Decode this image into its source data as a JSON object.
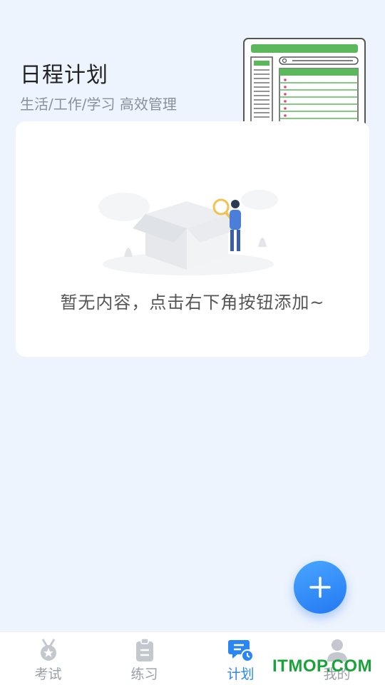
{
  "header": {
    "title": "日程计划",
    "subtitle": "生活/工作/学习 高效管理"
  },
  "empty_state": {
    "message": "暂无内容，点击右下角按钮添加~"
  },
  "fab": {
    "icon": "plus-icon"
  },
  "tabbar": {
    "tabs": [
      {
        "label": "考试",
        "icon": "medal-icon",
        "active": false
      },
      {
        "label": "练习",
        "icon": "clipboard-icon",
        "active": false
      },
      {
        "label": "计划",
        "icon": "plan-clock-icon",
        "active": true
      },
      {
        "label": "我的",
        "icon": "person-icon",
        "active": false
      }
    ]
  },
  "watermark": {
    "text": "ITMOP.COM"
  },
  "colors": {
    "background": "#eef4fd",
    "accent": "#2a86f2",
    "inactive": "#9aa0a8",
    "watermark": "#1aa33a"
  }
}
